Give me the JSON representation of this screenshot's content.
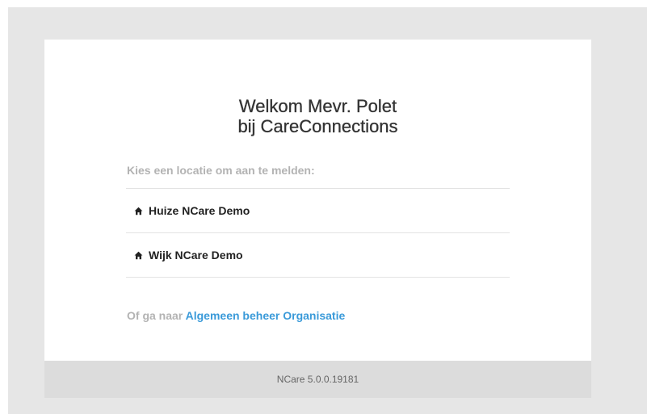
{
  "welcome": {
    "line1": "Welkom Mevr. Polet",
    "line2": "bij CareConnections"
  },
  "prompt": "Kies een locatie om aan te melden:",
  "locations": [
    {
      "label": "Huize NCare Demo",
      "icon": "home-icon"
    },
    {
      "label": "Wijk NCare Demo",
      "icon": "home-icon"
    }
  ],
  "alternative": {
    "prefix": "Of ga naar",
    "link_label": "Algemeen beheer Organisatie"
  },
  "footer": {
    "version": "NCare 5.0.0.19181"
  },
  "colors": {
    "background": "#e6e6e6",
    "link": "#3a9ad9",
    "muted": "#b3b3b3",
    "footer_bg": "#dcdcdc"
  }
}
